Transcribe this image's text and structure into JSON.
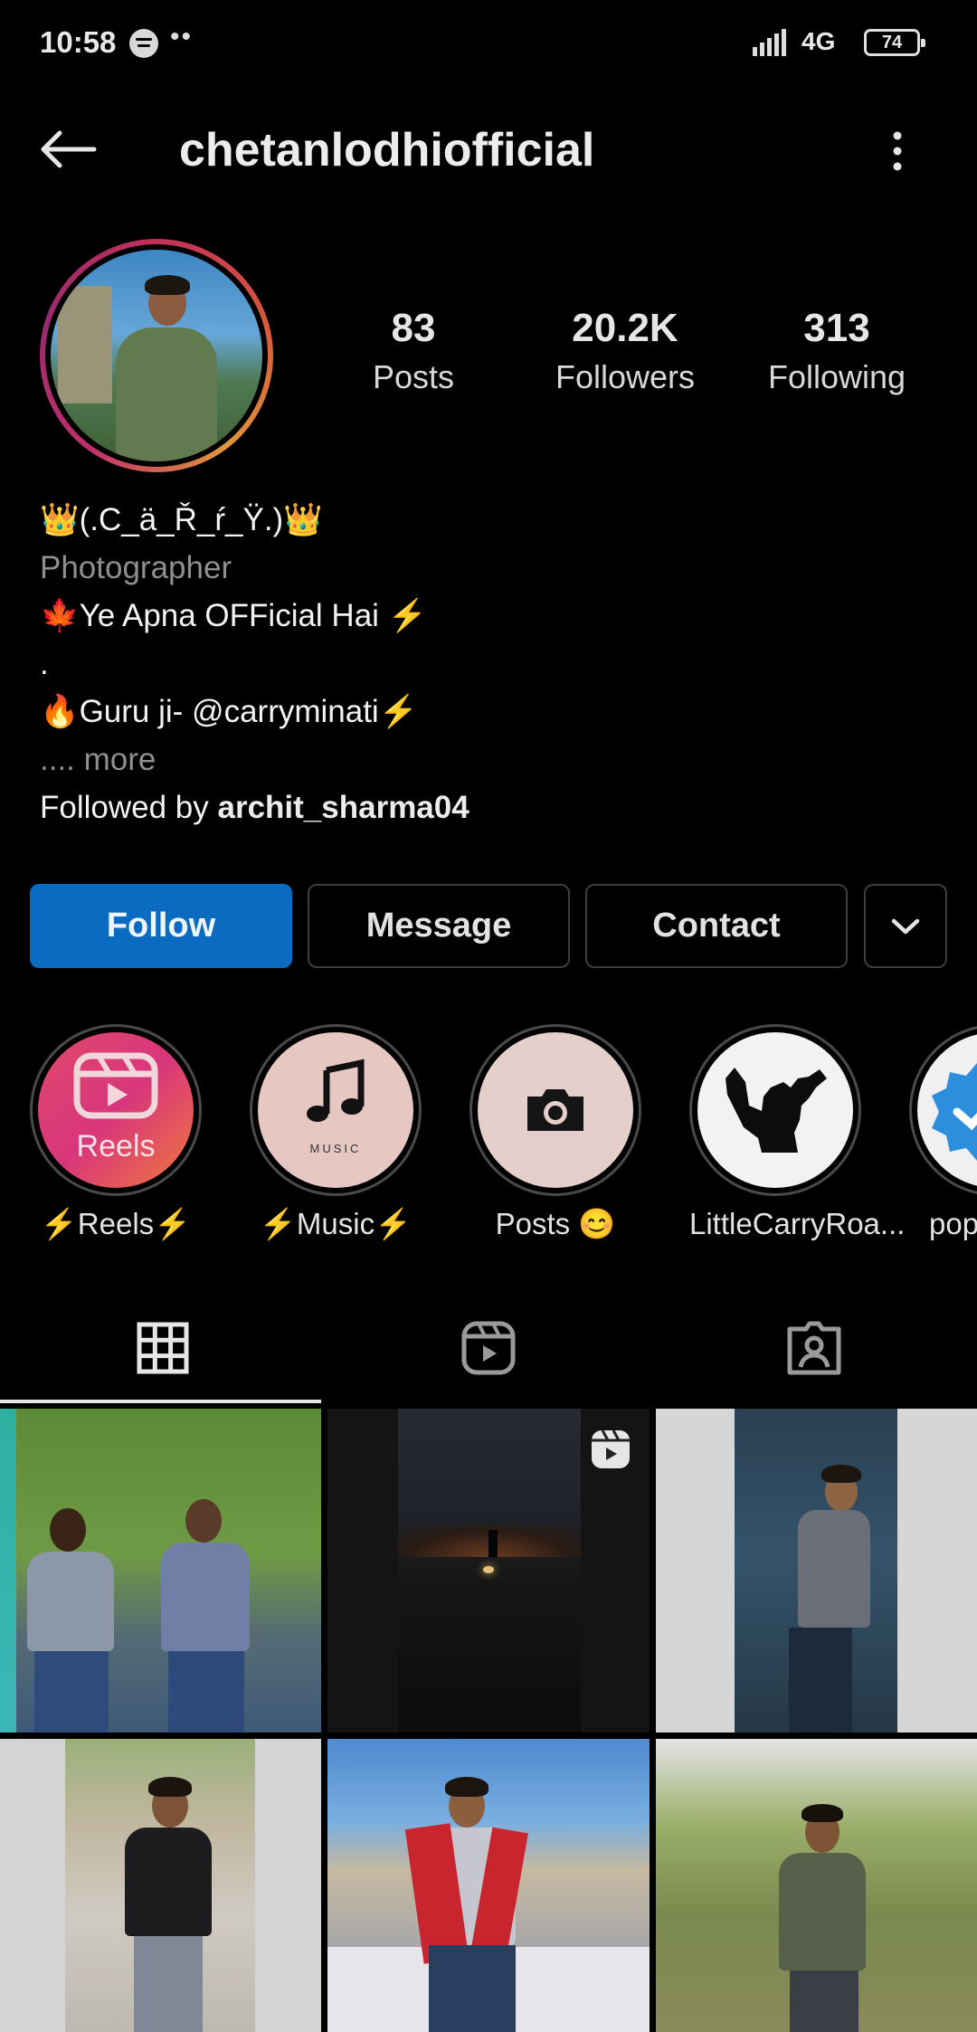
{
  "status_bar": {
    "time": "10:58",
    "dots": "••",
    "network": "4G",
    "battery": "74"
  },
  "header": {
    "username": "chetanlodhiofficial",
    "back_icon": "arrow-left-icon",
    "more_icon": "more-vertical-icon"
  },
  "stats": [
    {
      "value": "83",
      "label": "Posts"
    },
    {
      "value": "20.2K",
      "label": "Followers"
    },
    {
      "value": "313",
      "label": "Following"
    }
  ],
  "bio": {
    "name": "👑(.C_ä_Ř_ŕ_Ÿ.)👑",
    "category": "Photographer",
    "line1": "🍁Ye Apna OFFicial Hai ⚡",
    "line2": ".",
    "line3": "🔥Guru ji- @carryminati⚡",
    "more": ".... more",
    "followed_by_prefix": "Followed by ",
    "followed_by_user": "archit_sharma04"
  },
  "buttons": {
    "follow": "Follow",
    "message": "Message",
    "contact": "Contact",
    "dropdown_icon": "chevron-down-icon"
  },
  "highlights": [
    {
      "label": "⚡Reels⚡",
      "badge": "Reels"
    },
    {
      "label": "⚡Music⚡",
      "badge": "MUSIC"
    },
    {
      "label": "Posts 😊"
    },
    {
      "label": "LittleCarryRoa..."
    },
    {
      "label": "pop"
    }
  ],
  "tabs": [
    {
      "icon": "grid-icon",
      "active": true
    },
    {
      "icon": "reels-icon",
      "active": false
    },
    {
      "icon": "tagged-icon",
      "active": false
    }
  ]
}
